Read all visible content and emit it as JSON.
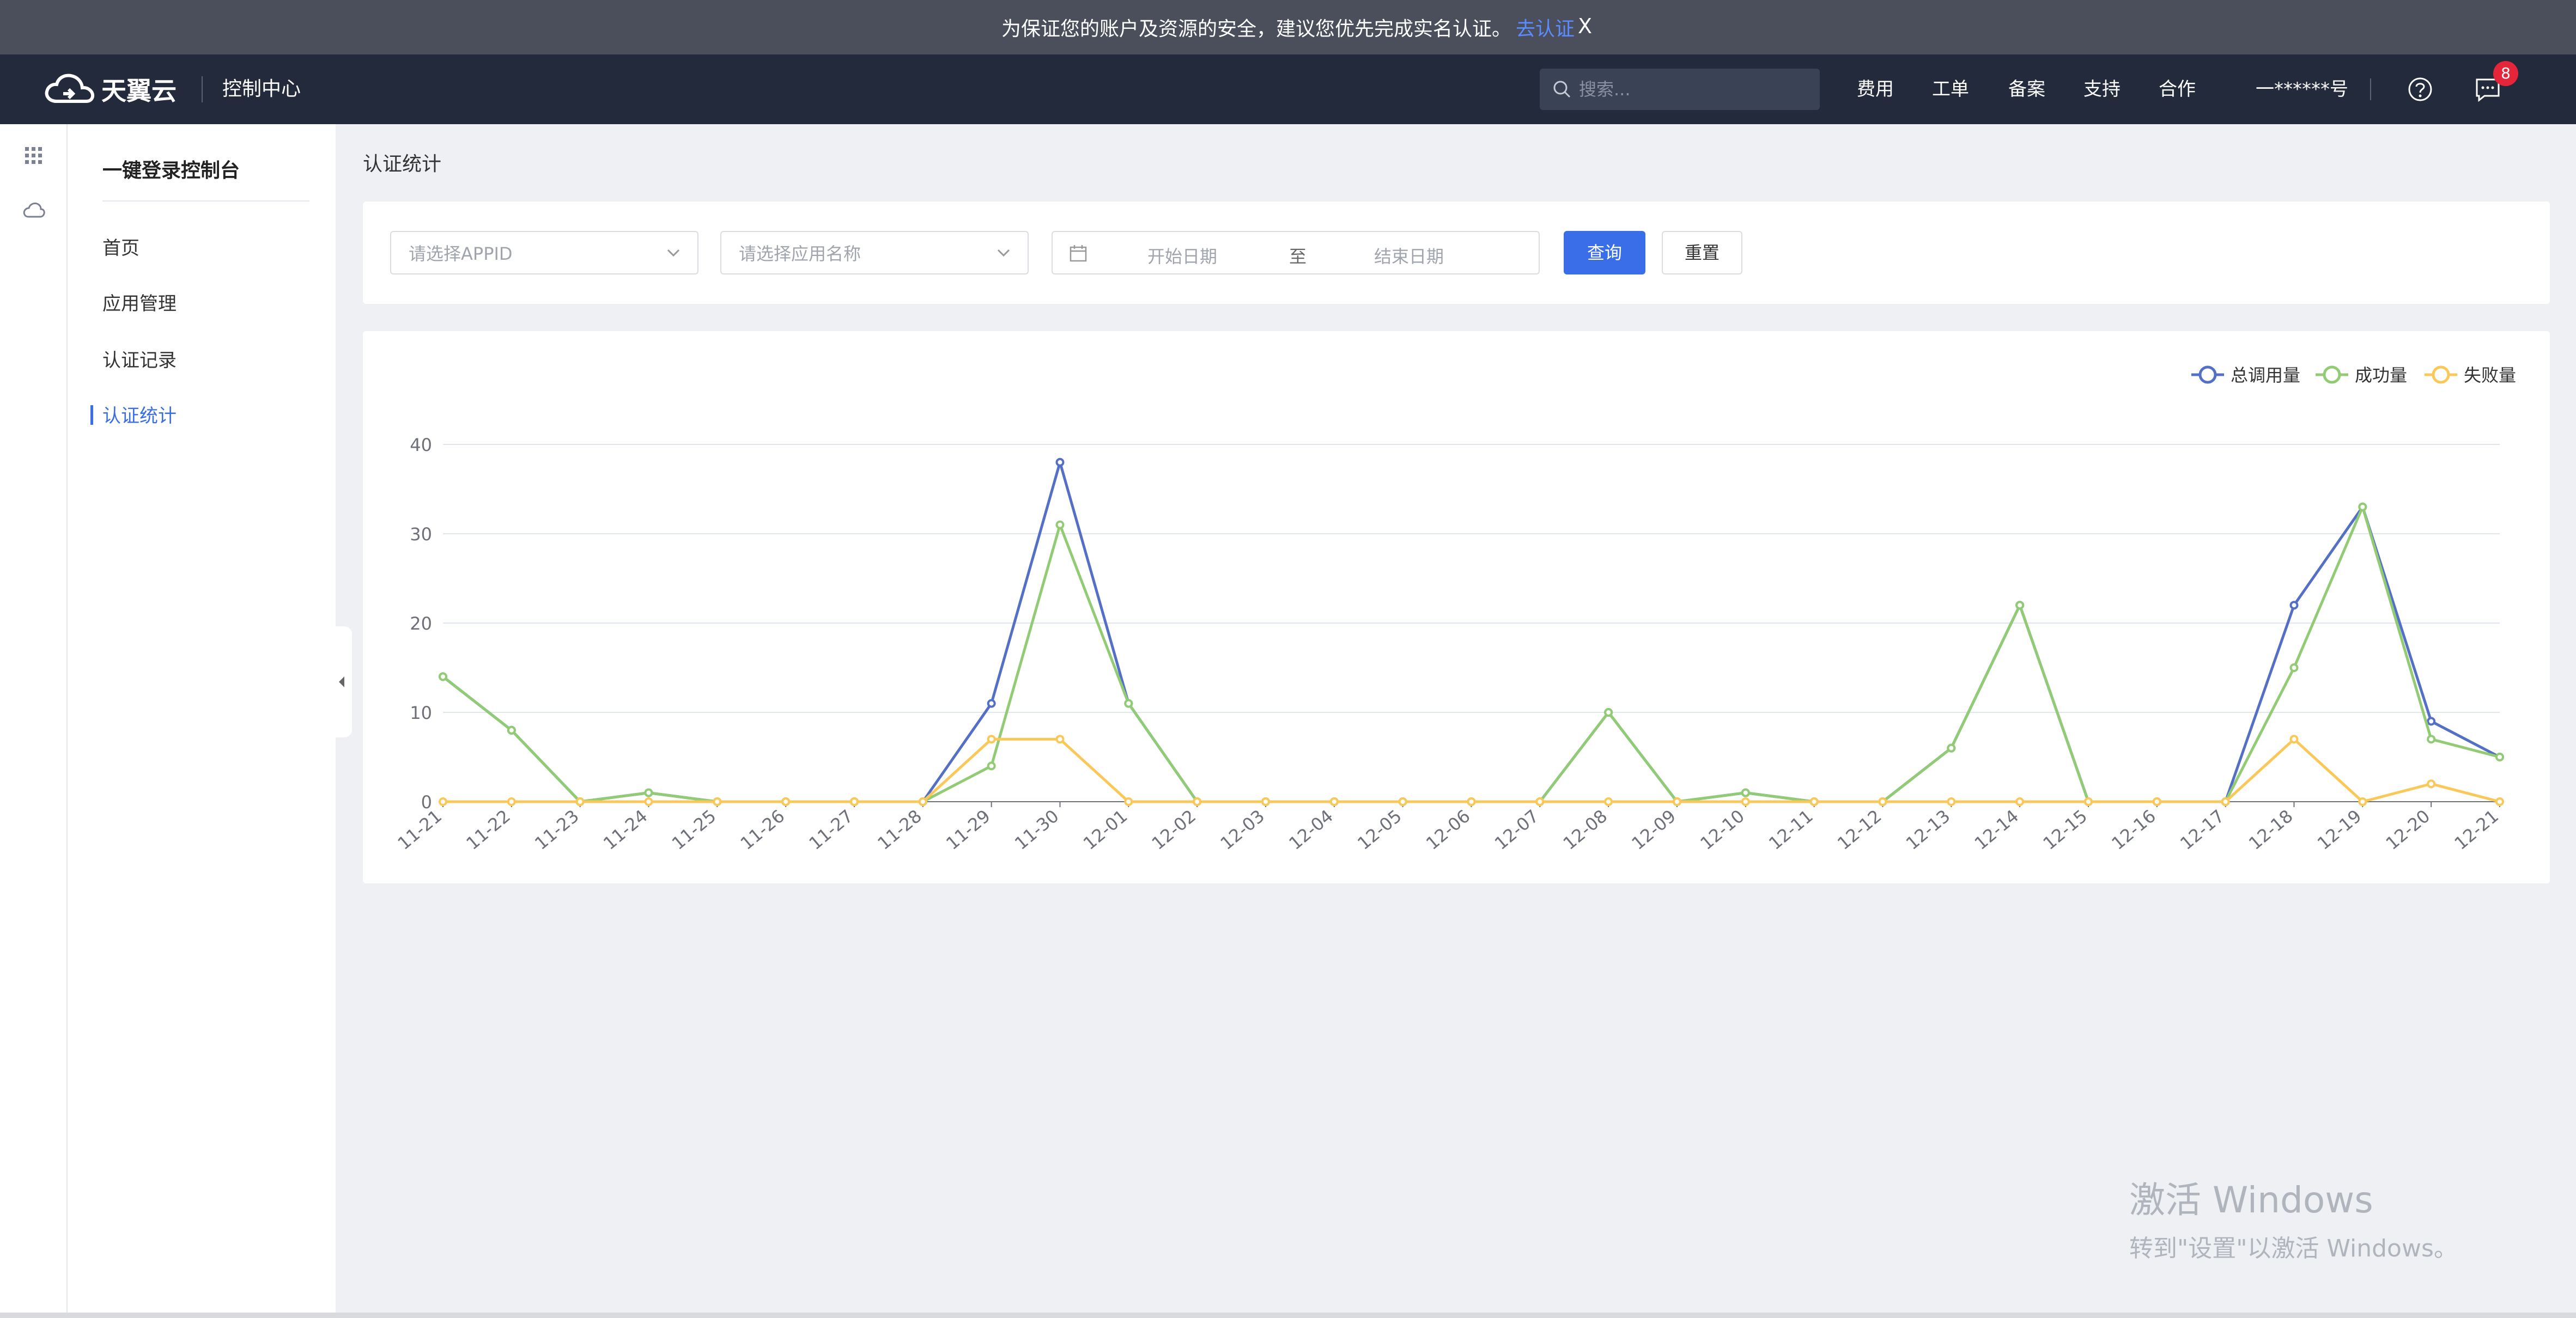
{
  "notice": {
    "text": "为保证您的账户及资源的安全，建议您优先完成实名认证。",
    "link": "去认证",
    "close": "X"
  },
  "header": {
    "logo_text": "天翼云",
    "console_title": "控制中心",
    "search_placeholder": "搜索...",
    "nav": [
      "费用",
      "工单",
      "备案",
      "支持",
      "合作"
    ],
    "account": "一******号",
    "badge_count": "8"
  },
  "sidebar": {
    "title": "一键登录控制台",
    "items": [
      {
        "label": "首页"
      },
      {
        "label": "应用管理"
      },
      {
        "label": "认证记录"
      },
      {
        "label": "认证统计"
      }
    ]
  },
  "main": {
    "title": "认证统计",
    "filters": {
      "appid_placeholder": "请选择APPID",
      "app_name_placeholder": "请选择应用名称",
      "start_date": "开始日期",
      "to": "至",
      "end_date": "结束日期",
      "query": "查询",
      "reset": "重置"
    }
  },
  "chart_data": {
    "type": "line",
    "x": [
      "11-21",
      "11-22",
      "11-23",
      "11-24",
      "11-25",
      "11-26",
      "11-27",
      "11-28",
      "11-29",
      "11-30",
      "12-01",
      "12-02",
      "12-03",
      "12-04",
      "12-05",
      "12-06",
      "12-07",
      "12-08",
      "12-09",
      "12-10",
      "12-11",
      "12-12",
      "12-13",
      "12-14",
      "12-15",
      "12-16",
      "12-17",
      "12-18",
      "12-19",
      "12-20",
      "12-21"
    ],
    "yticks": [
      0,
      10,
      20,
      30,
      40
    ],
    "ylim": [
      0,
      40
    ],
    "legend_position": "top-right",
    "grid": true,
    "series": [
      {
        "name": "总调用量",
        "color": "#5470c6",
        "values": [
          14,
          8,
          0,
          1,
          0,
          0,
          0,
          0,
          11,
          38,
          11,
          0,
          0,
          0,
          0,
          0,
          0,
          10,
          0,
          1,
          0,
          0,
          6,
          22,
          0,
          0,
          0,
          22,
          33,
          9,
          5
        ]
      },
      {
        "name": "成功量",
        "color": "#91cc75",
        "values": [
          14,
          8,
          0,
          1,
          0,
          0,
          0,
          0,
          4,
          31,
          11,
          0,
          0,
          0,
          0,
          0,
          0,
          10,
          0,
          1,
          0,
          0,
          6,
          22,
          0,
          0,
          0,
          15,
          33,
          7,
          5
        ]
      },
      {
        "name": "失败量",
        "color": "#fac858",
        "values": [
          0,
          0,
          0,
          0,
          0,
          0,
          0,
          0,
          7,
          7,
          0,
          0,
          0,
          0,
          0,
          0,
          0,
          0,
          0,
          0,
          0,
          0,
          0,
          0,
          0,
          0,
          0,
          7,
          0,
          2,
          0
        ]
      }
    ]
  },
  "watermark": {
    "line1": "激活 Windows",
    "line2": "转到\"设置\"以激活 Windows。"
  }
}
